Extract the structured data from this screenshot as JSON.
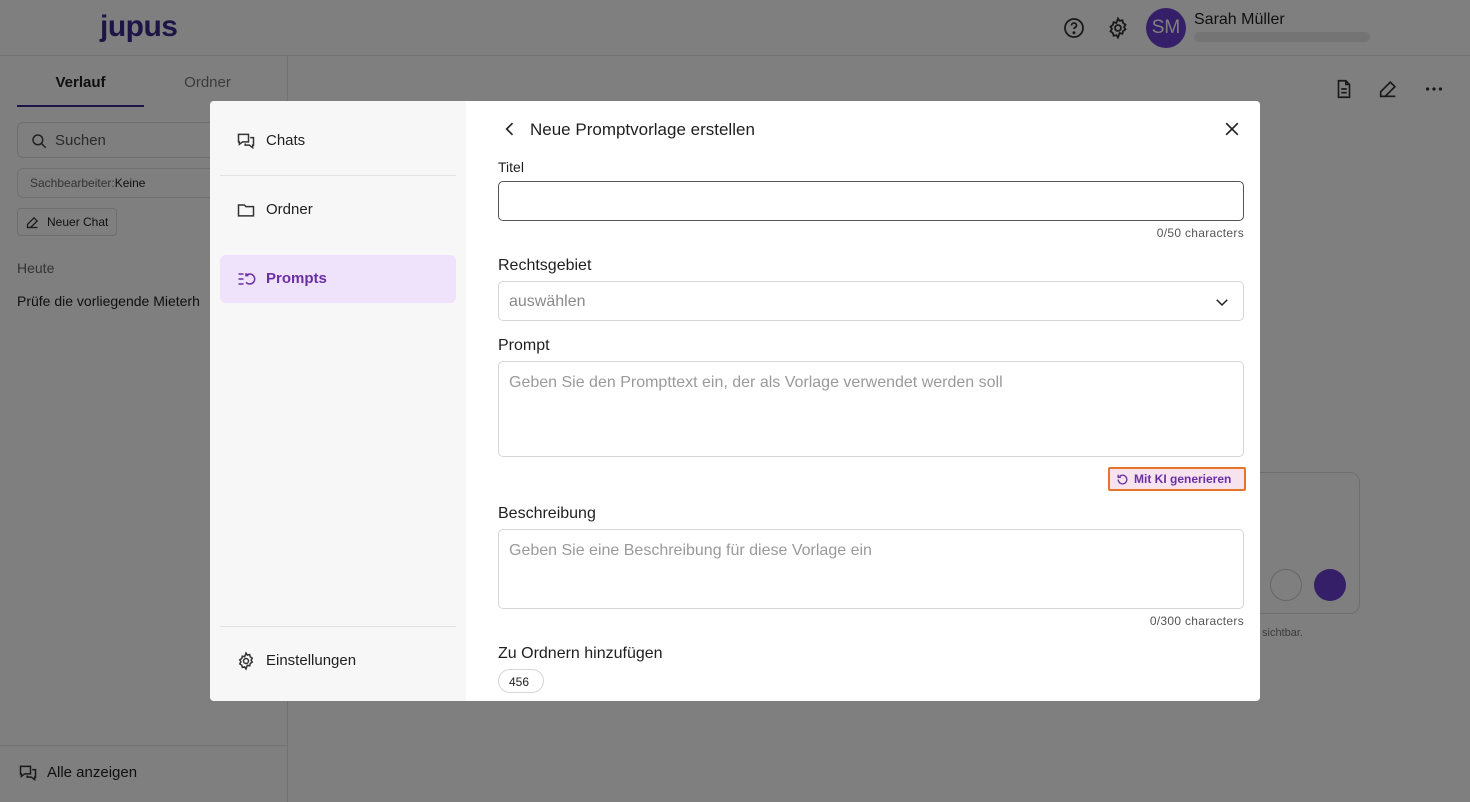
{
  "app": {
    "logo": "jupus",
    "user_initials": "SM",
    "user_name": "Sarah Müller"
  },
  "left_panel": {
    "tabs": [
      {
        "label": "Verlauf"
      },
      {
        "label": "Ordner"
      }
    ],
    "search_placeholder": "Suchen",
    "filter_label": "Sachbearbeiter:",
    "filter_value": "Keine",
    "new_chat_label": "Neuer Chat",
    "section_today": "Heute",
    "chat_item": "Prüfe die vorliegende Mieterh",
    "show_all_label": "Alle anzeigen"
  },
  "composer": {
    "note": "sichtbar."
  },
  "modal": {
    "nav": [
      {
        "label": "Chats",
        "icon": "chat-bubbles-icon"
      },
      {
        "label": "Ordner",
        "icon": "folder-icon"
      },
      {
        "label": "Prompts",
        "icon": "prompts-icon"
      }
    ],
    "settings_label": "Einstellungen",
    "title": "Neue Promptvorlage erstellen",
    "form": {
      "title_label": "Titel",
      "title_value": "",
      "title_count": "0/50 characters",
      "area_label": "Rechtsgebiet",
      "area_placeholder": "auswählen",
      "prompt_label": "Prompt",
      "prompt_placeholder": "Geben Sie den Prompttext ein, der als Vorlage verwendet werden soll",
      "ai_button_label": "Mit KI generieren",
      "description_label": "Beschreibung",
      "description_placeholder": "Geben Sie eine Beschreibung für diese Vorlage ein",
      "description_count": "0/300 characters",
      "folders_label": "Zu Ordnern hinzufügen",
      "folder_chip": "456"
    }
  },
  "colors": {
    "brand": "#3b2a8c",
    "accent": "#6b2fa5",
    "active_nav_bg": "#efe3fb",
    "highlight_border": "#e8742a"
  }
}
